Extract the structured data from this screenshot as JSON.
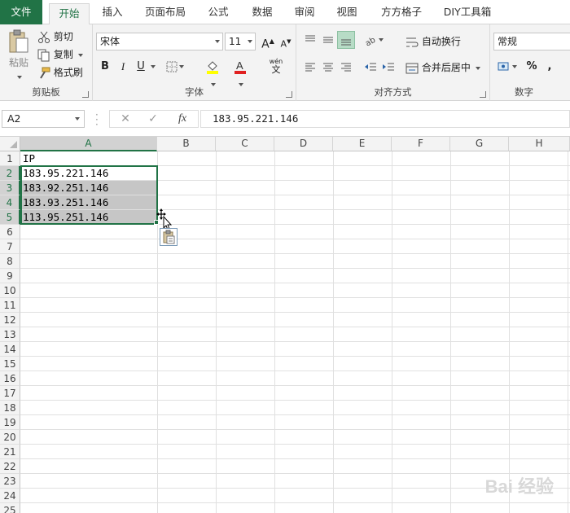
{
  "tabs": [
    {
      "label": "文件",
      "kind": "file"
    },
    {
      "label": "开始",
      "kind": "active"
    },
    {
      "label": "插入",
      "kind": ""
    },
    {
      "label": "页面布局",
      "kind": ""
    },
    {
      "label": "公式",
      "kind": ""
    },
    {
      "label": "数据",
      "kind": ""
    },
    {
      "label": "审阅",
      "kind": ""
    },
    {
      "label": "视图",
      "kind": ""
    },
    {
      "label": "方方格子",
      "kind": ""
    },
    {
      "label": "DIY工具箱",
      "kind": ""
    }
  ],
  "clipboard": {
    "paste": "粘贴",
    "cut": "剪切",
    "copy": "复制",
    "format_painter": "格式刷",
    "group": "剪贴板"
  },
  "font": {
    "name": "宋体",
    "size": "11",
    "bold": "B",
    "italic": "I",
    "underline": "U",
    "wen": "wén",
    "group": "字体"
  },
  "alignment": {
    "wrap": "自动换行",
    "merge": "合并后居中",
    "group": "对齐方式"
  },
  "number": {
    "format": "常规",
    "percent": "%",
    "comma": ",",
    "group": "数字"
  },
  "formula_bar": {
    "name_box": "A2",
    "fx": "fx",
    "value": "183.95.221.146"
  },
  "columns": [
    "A",
    "B",
    "C",
    "D",
    "E",
    "F",
    "G",
    "H"
  ],
  "rows": [
    "1",
    "2",
    "3",
    "4",
    "5",
    "6",
    "7",
    "8",
    "9",
    "10",
    "11",
    "12",
    "13",
    "14",
    "15",
    "16",
    "17",
    "18",
    "19",
    "20",
    "21",
    "22",
    "23",
    "24",
    "25"
  ],
  "cells": [
    "IP",
    "183.95.221.146",
    "183.92.251.146",
    "183.93.251.146",
    "113.95.251.146"
  ],
  "colors": {
    "accent": "#217346",
    "selection_fill": "#c6c6c6"
  },
  "watermark": "Bai 经验"
}
